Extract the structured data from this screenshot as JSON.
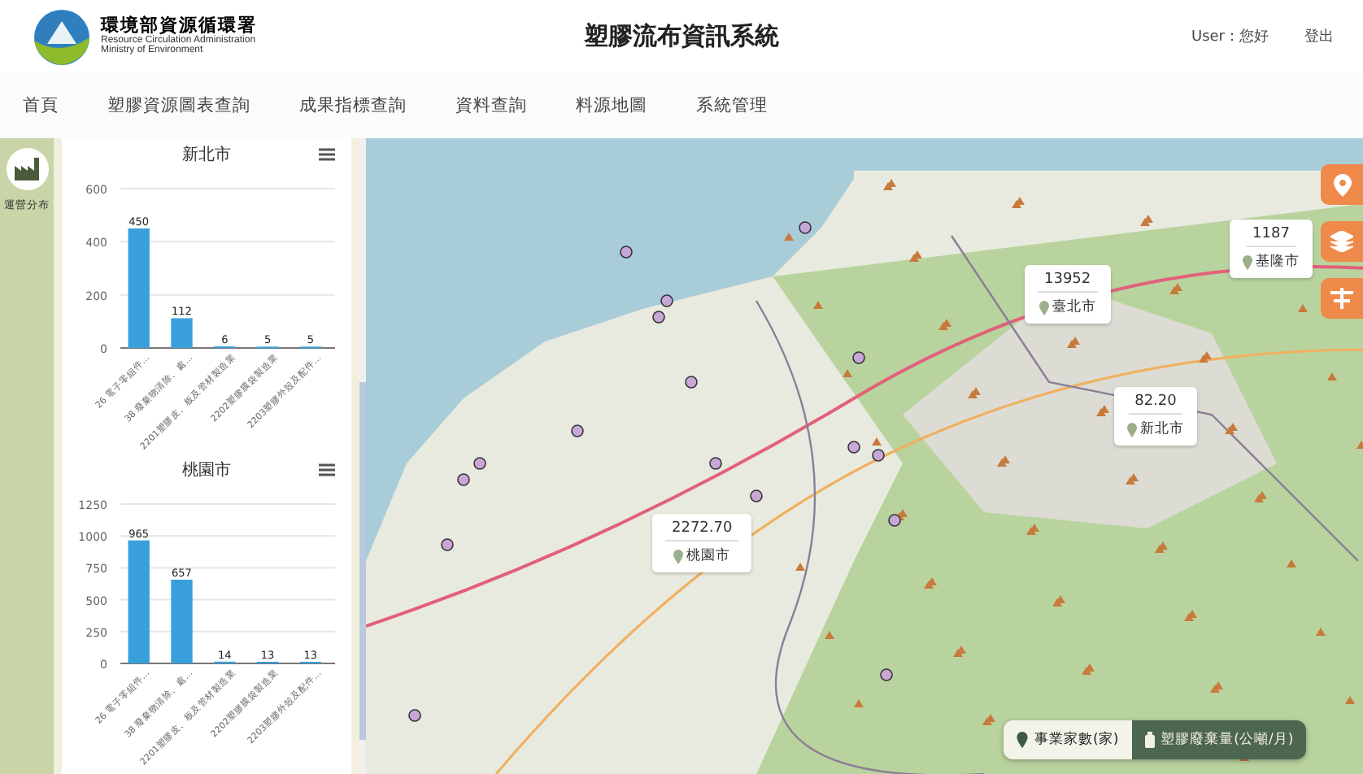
{
  "header": {
    "org_name": "環境部資源循環署",
    "org_name_en": [
      "Resource Circulation Administration",
      "Ministry of Environment"
    ],
    "title": "塑膠流布資訊系統",
    "user": "User：您好",
    "logout": "登出"
  },
  "nav": [
    "首頁",
    "塑膠資源圖表查詢",
    "成果指標查詢",
    "資料查詢",
    "料源地圖",
    "系統管理"
  ],
  "rail": {
    "label": "運營分布"
  },
  "charts": [
    {
      "chart_data": {
        "type": "bar",
        "title": "新北市",
        "categories": [
          "26 電子零組件…",
          "38 廢棄物清除、處…",
          "2201塑膠皮、板及管材製造業",
          "2202塑膠膜袋製造業",
          "2203塑膠外殼及配件…"
        ],
        "values": [
          450,
          112,
          6,
          5,
          5
        ],
        "grid": true,
        "ylim": [
          0,
          600
        ],
        "yticks": [
          0,
          200,
          400,
          600
        ],
        "data_labels": true
      }
    },
    {
      "chart_data": {
        "type": "bar",
        "title": "桃園市",
        "categories": [
          "26 電子零組件…",
          "38 廢棄物清除、處…",
          "2201塑膠皮、板及管材製造業",
          "2202塑膠膜袋製造業",
          "2203塑膠外殼及配件…"
        ],
        "values": [
          965,
          657,
          14,
          13,
          13
        ],
        "grid": true,
        "ylim": [
          0,
          1250
        ],
        "yticks": [
          0,
          250,
          500,
          750,
          1000,
          1250
        ],
        "data_labels": true
      }
    }
  ],
  "popups": [
    {
      "value": "13952",
      "city": "臺北市"
    },
    {
      "value": "1187",
      "city": "基隆市"
    },
    {
      "value": "82.20",
      "city": "新北市"
    },
    {
      "value": "2272.70",
      "city": "桃園市"
    }
  ],
  "legend": [
    {
      "label": "事業家數(家)",
      "kind": "pin",
      "selected": false
    },
    {
      "label": "塑膠廢棄量(公噸/月)",
      "kind": "bin",
      "selected": true
    }
  ]
}
